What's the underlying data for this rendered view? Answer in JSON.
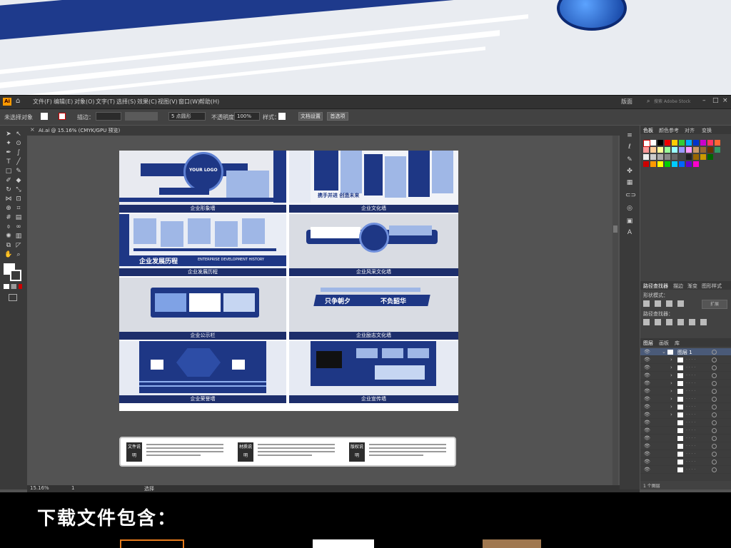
{
  "menu": {
    "app_badge": "Ai",
    "items": [
      "文件(F)",
      "编辑(E)",
      "对象(O)",
      "文字(T)",
      "选择(S)",
      "效果(C)",
      "视图(V)",
      "窗口(W)",
      "帮助(H)"
    ],
    "workspace": "版面",
    "search_placeholder": "搜索 Adobe Stock"
  },
  "control": {
    "selection": "未选择对象",
    "stroke_label": "描边：",
    "brush_label": "5 点圆形",
    "opacity_label": "不透明度：",
    "opacity_value": "100%",
    "style_label": "样式：",
    "doc_setup": "文档设置",
    "preferences": "首选项"
  },
  "doc_tab": "AI.ai @ 15.16% (CMYK/GPU 预览)",
  "artboard": {
    "cards": [
      {
        "caption": "企业形象墙",
        "text1": "YOUR LOGO",
        "text2": "PRACTICE MAKES PERFECT"
      },
      {
        "caption": "企业文化墙",
        "text1": "携手并进 创造未来",
        "text2": ""
      },
      {
        "caption": "企业发展历程",
        "text1": "企业发展历程",
        "text2": "ENTERPRISE DEVELOPMENT HISTORY"
      },
      {
        "caption": "企业风采文化墙",
        "text1": "",
        "text2": ""
      },
      {
        "caption": "企业公示栏",
        "text1": "",
        "text2": ""
      },
      {
        "caption": "企业励志文化墙",
        "text1": "只争朝夕",
        "text2": "不负韶华"
      },
      {
        "caption": "企业荣誉墙",
        "text1": "",
        "text2": ""
      },
      {
        "caption": "企业宣传墙",
        "text1": "",
        "text2": ""
      }
    ]
  },
  "info": [
    {
      "tag": "文件说明"
    },
    {
      "tag": "材质说明"
    },
    {
      "tag": "版权说明"
    }
  ],
  "status": {
    "zoom": "15.16%",
    "page": "1",
    "tool": "选择"
  },
  "panels": {
    "top_tabs": [
      "色板",
      "颜色参考",
      "对齐",
      "变换"
    ],
    "path_tabs": [
      "路径查找器",
      "描边",
      "渐变",
      "图形样式"
    ],
    "shape_modes": "形状模式：",
    "expand": "扩展",
    "pathfinder": "路径查找器：",
    "layer_tabs": [
      "图层",
      "画板",
      "库"
    ],
    "layer_name": "图层 1",
    "layer_count": "1 个图层"
  },
  "bottom": {
    "title": "下载文件包含："
  },
  "colors": {
    "navy": "#1e3785",
    "dark_ui": "#424242",
    "canvas": "#535353"
  }
}
